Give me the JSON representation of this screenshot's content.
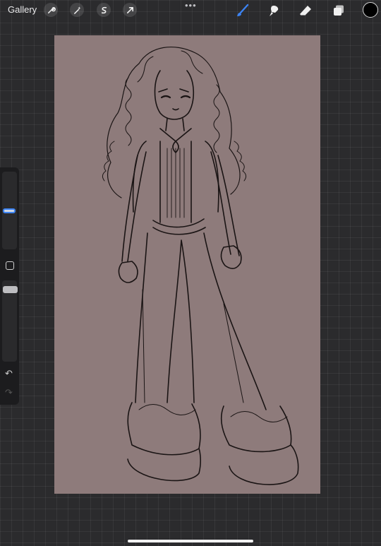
{
  "topbar": {
    "gallery_label": "Gallery",
    "more_label": "•••",
    "left_tools": [
      "wrench-icon",
      "magic-wand-icon",
      "selection-icon",
      "transform-arrow-icon"
    ],
    "right_tools": [
      "brush-icon",
      "smudge-icon",
      "eraser-icon",
      "layers-icon"
    ],
    "active_tool": "brush-icon",
    "accent_color": "#3c83f2",
    "current_color": "#000000"
  },
  "sidebar": {
    "undo_icon": "↶",
    "redo_icon": "↷"
  },
  "canvas": {
    "background_color": "#8e7b7b",
    "content": "sketch-drawing"
  }
}
